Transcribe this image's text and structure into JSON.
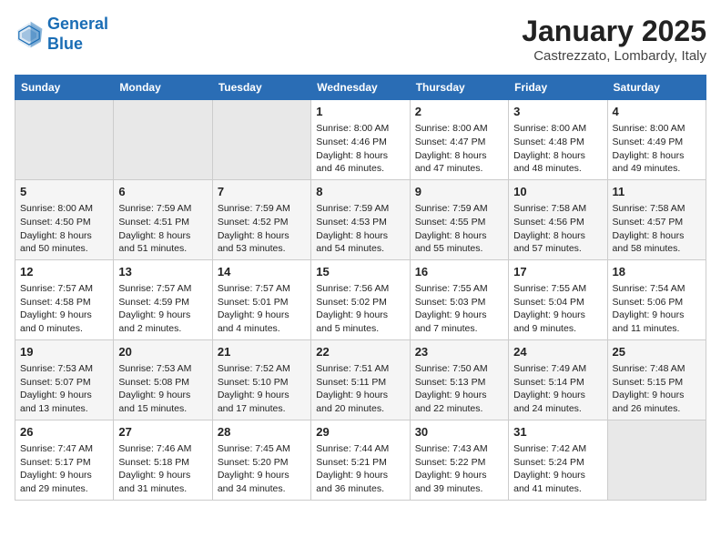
{
  "logo": {
    "line1": "General",
    "line2": "Blue"
  },
  "title": "January 2025",
  "subtitle": "Castrezzato, Lombardy, Italy",
  "weekdays": [
    "Sunday",
    "Monday",
    "Tuesday",
    "Wednesday",
    "Thursday",
    "Friday",
    "Saturday"
  ],
  "weeks": [
    [
      {
        "day": "",
        "content": ""
      },
      {
        "day": "",
        "content": ""
      },
      {
        "day": "",
        "content": ""
      },
      {
        "day": "1",
        "content": "Sunrise: 8:00 AM\nSunset: 4:46 PM\nDaylight: 8 hours\nand 46 minutes."
      },
      {
        "day": "2",
        "content": "Sunrise: 8:00 AM\nSunset: 4:47 PM\nDaylight: 8 hours\nand 47 minutes."
      },
      {
        "day": "3",
        "content": "Sunrise: 8:00 AM\nSunset: 4:48 PM\nDaylight: 8 hours\nand 48 minutes."
      },
      {
        "day": "4",
        "content": "Sunrise: 8:00 AM\nSunset: 4:49 PM\nDaylight: 8 hours\nand 49 minutes."
      }
    ],
    [
      {
        "day": "5",
        "content": "Sunrise: 8:00 AM\nSunset: 4:50 PM\nDaylight: 8 hours\nand 50 minutes."
      },
      {
        "day": "6",
        "content": "Sunrise: 7:59 AM\nSunset: 4:51 PM\nDaylight: 8 hours\nand 51 minutes."
      },
      {
        "day": "7",
        "content": "Sunrise: 7:59 AM\nSunset: 4:52 PM\nDaylight: 8 hours\nand 53 minutes."
      },
      {
        "day": "8",
        "content": "Sunrise: 7:59 AM\nSunset: 4:53 PM\nDaylight: 8 hours\nand 54 minutes."
      },
      {
        "day": "9",
        "content": "Sunrise: 7:59 AM\nSunset: 4:55 PM\nDaylight: 8 hours\nand 55 minutes."
      },
      {
        "day": "10",
        "content": "Sunrise: 7:58 AM\nSunset: 4:56 PM\nDaylight: 8 hours\nand 57 minutes."
      },
      {
        "day": "11",
        "content": "Sunrise: 7:58 AM\nSunset: 4:57 PM\nDaylight: 8 hours\nand 58 minutes."
      }
    ],
    [
      {
        "day": "12",
        "content": "Sunrise: 7:57 AM\nSunset: 4:58 PM\nDaylight: 9 hours\nand 0 minutes."
      },
      {
        "day": "13",
        "content": "Sunrise: 7:57 AM\nSunset: 4:59 PM\nDaylight: 9 hours\nand 2 minutes."
      },
      {
        "day": "14",
        "content": "Sunrise: 7:57 AM\nSunset: 5:01 PM\nDaylight: 9 hours\nand 4 minutes."
      },
      {
        "day": "15",
        "content": "Sunrise: 7:56 AM\nSunset: 5:02 PM\nDaylight: 9 hours\nand 5 minutes."
      },
      {
        "day": "16",
        "content": "Sunrise: 7:55 AM\nSunset: 5:03 PM\nDaylight: 9 hours\nand 7 minutes."
      },
      {
        "day": "17",
        "content": "Sunrise: 7:55 AM\nSunset: 5:04 PM\nDaylight: 9 hours\nand 9 minutes."
      },
      {
        "day": "18",
        "content": "Sunrise: 7:54 AM\nSunset: 5:06 PM\nDaylight: 9 hours\nand 11 minutes."
      }
    ],
    [
      {
        "day": "19",
        "content": "Sunrise: 7:53 AM\nSunset: 5:07 PM\nDaylight: 9 hours\nand 13 minutes."
      },
      {
        "day": "20",
        "content": "Sunrise: 7:53 AM\nSunset: 5:08 PM\nDaylight: 9 hours\nand 15 minutes."
      },
      {
        "day": "21",
        "content": "Sunrise: 7:52 AM\nSunset: 5:10 PM\nDaylight: 9 hours\nand 17 minutes."
      },
      {
        "day": "22",
        "content": "Sunrise: 7:51 AM\nSunset: 5:11 PM\nDaylight: 9 hours\nand 20 minutes."
      },
      {
        "day": "23",
        "content": "Sunrise: 7:50 AM\nSunset: 5:13 PM\nDaylight: 9 hours\nand 22 minutes."
      },
      {
        "day": "24",
        "content": "Sunrise: 7:49 AM\nSunset: 5:14 PM\nDaylight: 9 hours\nand 24 minutes."
      },
      {
        "day": "25",
        "content": "Sunrise: 7:48 AM\nSunset: 5:15 PM\nDaylight: 9 hours\nand 26 minutes."
      }
    ],
    [
      {
        "day": "26",
        "content": "Sunrise: 7:47 AM\nSunset: 5:17 PM\nDaylight: 9 hours\nand 29 minutes."
      },
      {
        "day": "27",
        "content": "Sunrise: 7:46 AM\nSunset: 5:18 PM\nDaylight: 9 hours\nand 31 minutes."
      },
      {
        "day": "28",
        "content": "Sunrise: 7:45 AM\nSunset: 5:20 PM\nDaylight: 9 hours\nand 34 minutes."
      },
      {
        "day": "29",
        "content": "Sunrise: 7:44 AM\nSunset: 5:21 PM\nDaylight: 9 hours\nand 36 minutes."
      },
      {
        "day": "30",
        "content": "Sunrise: 7:43 AM\nSunset: 5:22 PM\nDaylight: 9 hours\nand 39 minutes."
      },
      {
        "day": "31",
        "content": "Sunrise: 7:42 AM\nSunset: 5:24 PM\nDaylight: 9 hours\nand 41 minutes."
      },
      {
        "day": "",
        "content": ""
      }
    ]
  ]
}
